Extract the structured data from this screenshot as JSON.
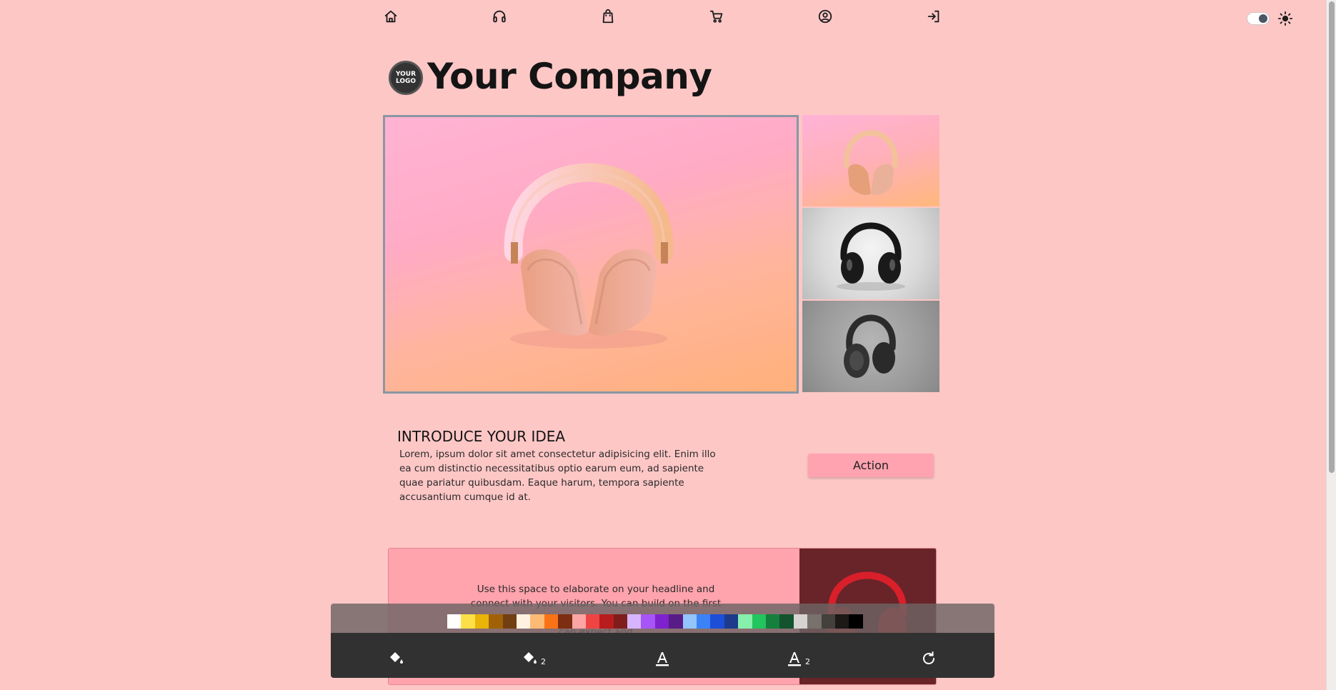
{
  "nav": {
    "icons": [
      "home-icon",
      "headphones-icon",
      "shopping-bag-icon",
      "cart-icon",
      "user-circle-icon",
      "login-icon"
    ],
    "theme_toggle": {
      "state": "off"
    },
    "theme_icon": "sun-icon"
  },
  "brand": {
    "logo_line1": "YOUR",
    "logo_line2": "LOGO",
    "company_name": "Your Company"
  },
  "gallery": {
    "main_image": "pink headphones on pink-orange background",
    "thumbnails": [
      "pink headphones",
      "black headphones on white",
      "black headphones on grey"
    ]
  },
  "intro": {
    "title": "INTRODUCE YOUR IDEA",
    "body": "Lorem, ipsum dolor sit amet consectetur adipisicing elit. Enim illo ea cum distinctio necessitatibus optio earum eum, ad sapiente quae pariatur quibusdam. Eaque harum, tempora sapiente accusantium cumque id at.",
    "action_label": "Action"
  },
  "feature": {
    "text": "Use this space to elaborate on your headline and connect with your visitors. You can build on the first idea or add another idea to let them know what they can expect and"
  },
  "palette": {
    "colors": [
      "#ffffff",
      "#fde047",
      "#eab308",
      "#a16207",
      "#713f12",
      "#fff2e0",
      "#fdba74",
      "#f97316",
      "#7c2d12",
      "#fca5a5",
      "#ef4444",
      "#b91c1c",
      "#7f1d1d",
      "#d8b4fe",
      "#a855f7",
      "#7e22ce",
      "#581c87",
      "#93c5fd",
      "#3b82f6",
      "#1d4ed8",
      "#1e3a8a",
      "#86efac",
      "#22c55e",
      "#15803d",
      "#14532d",
      "#d6d3d1",
      "#78716c",
      "#44403c",
      "#1c1917",
      "#000000"
    ]
  },
  "toolbar": {
    "tools": [
      {
        "name": "fill-icon",
        "sub": ""
      },
      {
        "name": "fill-icon",
        "sub": "2"
      },
      {
        "name": "text-color-icon",
        "sub": ""
      },
      {
        "name": "text-color-icon",
        "sub": "2"
      },
      {
        "name": "reset-icon",
        "sub": ""
      }
    ]
  }
}
